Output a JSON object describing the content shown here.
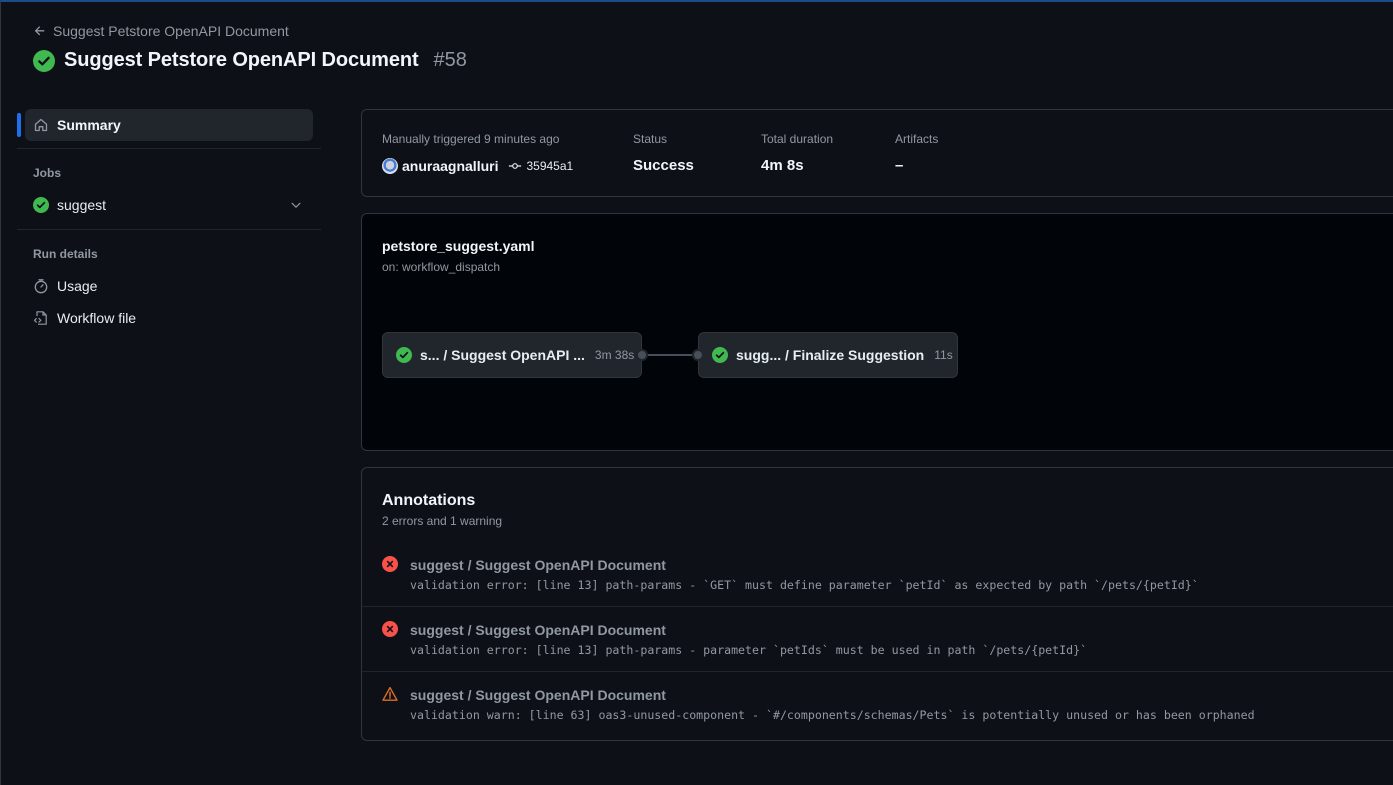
{
  "header": {
    "back_label": "Suggest Petstore OpenAPI Document",
    "title": "Suggest Petstore OpenAPI Document",
    "run_number": "#58",
    "status_icon": "check-circle-fill-icon"
  },
  "sidebar": {
    "summary_label": "Summary",
    "jobs_heading": "Jobs",
    "jobs": [
      {
        "label": "suggest",
        "status": "success"
      }
    ],
    "run_details_heading": "Run details",
    "run_details": [
      {
        "label": "Usage",
        "icon": "stopwatch-icon"
      },
      {
        "label": "Workflow file",
        "icon": "file-code-icon"
      }
    ]
  },
  "summary": {
    "trigger_label": "Manually triggered 9 minutes ago",
    "actor": "anuraagnalluri",
    "commit": "35945a1",
    "status_label": "Status",
    "status_value": "Success",
    "duration_label": "Total duration",
    "duration_value": "4m 8s",
    "artifacts_label": "Artifacts",
    "artifacts_value": "–"
  },
  "workflow": {
    "file": "petstore_suggest.yaml",
    "trigger": "on: workflow_dispatch",
    "jobs": [
      {
        "name": "s... / Suggest OpenAPI ...",
        "duration": "3m 38s",
        "status": "success"
      },
      {
        "name": "sugg...  / Finalize Suggestion",
        "duration": "11s",
        "status": "success"
      }
    ]
  },
  "annotations": {
    "title": "Annotations",
    "subtitle": "2 errors and 1 warning",
    "items": [
      {
        "level": "error",
        "job": "suggest / Suggest OpenAPI Document",
        "message": "validation error: [line 13] path-params - `GET` must define parameter `petId` as expected by path `/pets/{petId}`"
      },
      {
        "level": "error",
        "job": "suggest / Suggest OpenAPI Document",
        "message": "validation error: [line 13] path-params - parameter `petIds` must be used in path `/pets/{petId}`"
      },
      {
        "level": "warning",
        "job": "suggest / Suggest OpenAPI Document",
        "message": "validation warn: [line 63] oas3-unused-component - `#/components/schemas/Pets` is potentially unused or has been orphaned"
      }
    ]
  },
  "colors": {
    "success": "#3fb950",
    "error": "#f85149",
    "warning": "#db6d28",
    "accent": "#1f6feb"
  }
}
